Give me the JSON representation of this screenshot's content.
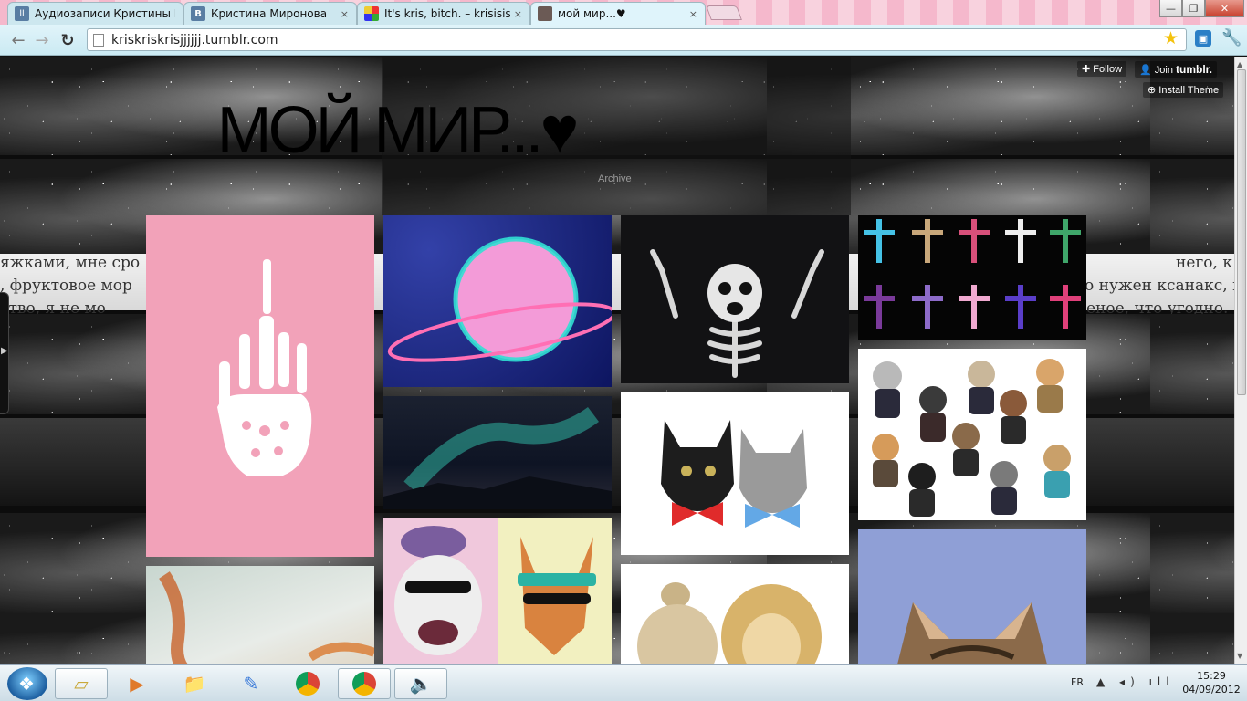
{
  "browser": {
    "tabs": [
      {
        "label": "Аудиозаписи Кристины М",
        "favicon_color": "#597da3",
        "favicon_text": "II",
        "active": false
      },
      {
        "label": "Кристина Миронова",
        "favicon_color": "#597da3",
        "favicon_text": "B",
        "active": false
      },
      {
        "label": "It's kris, bitch. – krisisisisis",
        "favicon_color": "#e33",
        "favicon_text": "",
        "active": false
      },
      {
        "label": "мой мир...♥",
        "favicon_color": "#6b5a55",
        "favicon_text": "",
        "active": true
      }
    ],
    "close_symbol": "×",
    "url": "kriskriskrisjjjjjj.tumblr.com",
    "window_controls": {
      "minimize": "—",
      "maximize": "❐",
      "close": "✕"
    }
  },
  "page": {
    "title": "МОЙ МИР...♥",
    "archive_label": "Archive",
    "follow_label": "Follow",
    "join_label": "Join",
    "join_brand": "tumblr.",
    "install_label": "Install Theme",
    "background_text": {
      "line1_left": "яжками, мне сро",
      "line2_left": ", фруктовое мор",
      "line3_left": "ство, я не мо",
      "line1_right": "него, к",
      "line2_right": "о нужен ксанакс, в",
      "line3_right": "еное, что угодно."
    }
  },
  "posts": [
    {
      "name": "skeleton-hand-post",
      "bg": "#f2a2b9"
    },
    {
      "name": "orange-splash-post",
      "bg": "#dfe3e0"
    },
    {
      "name": "planet-post",
      "bg": "#1a2a8a"
    },
    {
      "name": "aurora-post",
      "bg": "#141a2e"
    },
    {
      "name": "bear-fox-post",
      "bg": "#f0c8dc"
    },
    {
      "name": "skeleton-post",
      "bg": "#121214"
    },
    {
      "name": "bowtie-cats-post",
      "bg": "#ffffff"
    },
    {
      "name": "girl-lion-post",
      "bg": "#ffffff"
    },
    {
      "name": "crosses-post",
      "bg": "#050505"
    },
    {
      "name": "suit-cats-post",
      "bg": "#ffffff"
    },
    {
      "name": "cat-post",
      "bg": "#8f9fd6"
    }
  ],
  "taskbar": {
    "language": "FR",
    "time": "15:29",
    "date": "04/09/2012",
    "tray_icons": "▲ ◂) ıll"
  }
}
